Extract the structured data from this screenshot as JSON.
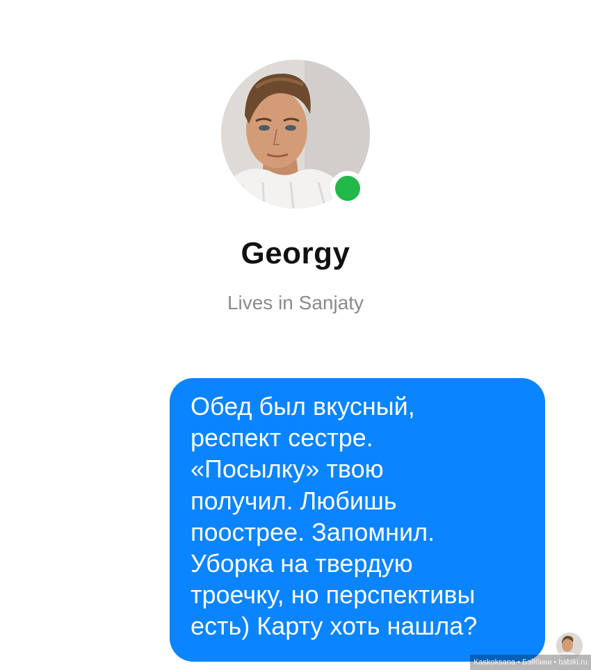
{
  "profile": {
    "name": "Georgy",
    "subtitle": "Lives in Sanjaty",
    "avatar_icon": "profile-photo",
    "status": "online",
    "status_color": "#22b84a"
  },
  "message": {
    "bubble_color": "#0a84ff",
    "lines": [
      "Обед был вкусный,",
      "респект сестре.",
      "«Посылку» твою",
      "получил. Любишь",
      "поострее. Запомнил.",
      "Уборка на твердую",
      "троечку, но перспективы",
      "есть) Карту хоть нашла?"
    ]
  },
  "watermark": {
    "text": "Kaskoksana • Бэйбики • babiki.ru"
  }
}
